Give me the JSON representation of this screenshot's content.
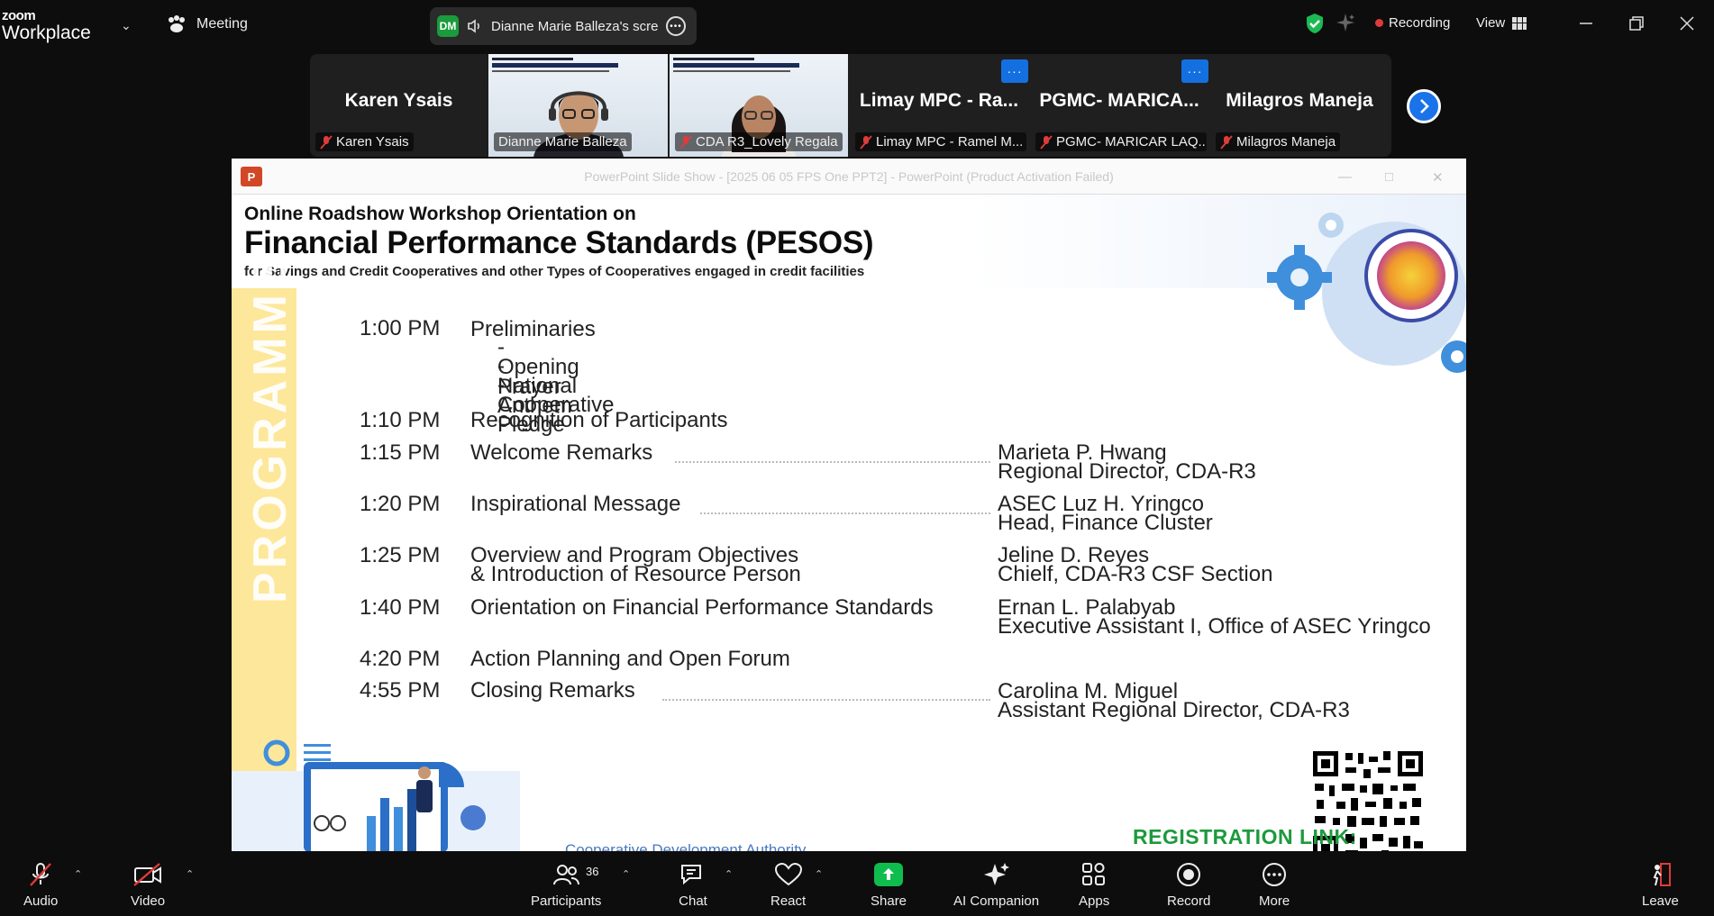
{
  "app": {
    "brand_top": "zoom",
    "brand_bottom": "Workplace",
    "meeting_label": "Meeting",
    "share_initials": "DM",
    "share_label": "Dianne Marie Balleza's screen",
    "recording_label": "Recording",
    "view_label": "View",
    "colors": {
      "accent": "#1a73e8",
      "recording": "#e03b3b",
      "share_green": "#0fbd4f",
      "active_speaker": "#22c55e"
    }
  },
  "gallery": {
    "tiles": [
      {
        "big_name": "Karen Ysais",
        "tag": "Karen Ysais",
        "muted": true
      },
      {
        "big_name": "",
        "tag": "Dianne Marie Balleza",
        "muted": false,
        "video": true,
        "active": true
      },
      {
        "big_name": "",
        "tag": "CDA R3_Lovely Regala",
        "muted": true,
        "video": true
      },
      {
        "big_name": "Limay MPC - Ra...",
        "tag": "Limay MPC - Ramel M...",
        "muted": true,
        "menu": "···"
      },
      {
        "big_name": "PGMC- MARICA...",
        "tag": "PGMC- MARICAR LAQ...",
        "muted": true,
        "menu": "···"
      },
      {
        "big_name": "Milagros Maneja",
        "tag": "Milagros Maneja",
        "muted": true
      }
    ]
  },
  "ppt": {
    "window_title": "PowerPoint Slide Show  -  [2025 06 05 FPS One PPT2]  -  PowerPoint (Product Activation Failed)",
    "icon_letter": "P"
  },
  "slide": {
    "line1": "Online Roadshow Workshop Orientation on",
    "line2": "Financial Performance Standards (PESOS)",
    "line3": "for Savings and Credit Cooperatives and other Types of Cooperatives engaged in credit facilities",
    "band_label": "PROGRAMME",
    "schedule": [
      {
        "time": "1:00 PM",
        "activity": "Preliminaries",
        "speaker": "",
        "speaker_title": ""
      },
      {
        "time": "1:10 PM",
        "activity": "Recognition of Participants",
        "speaker": "",
        "speaker_title": ""
      },
      {
        "time": "1:15 PM",
        "activity": "Welcome Remarks",
        "speaker": "Marieta P. Hwang",
        "speaker_title": "Regional Director, CDA-R3"
      },
      {
        "time": "1:20 PM",
        "activity": "Inspirational Message",
        "speaker": "ASEC Luz H. Yringco",
        "speaker_title": "Head, Finance Cluster"
      },
      {
        "time": "1:25 PM",
        "activity": "Overview and Program Objectives",
        "activity2": "& Introduction of Resource Person",
        "speaker": "Jeline D. Reyes",
        "speaker_title": "Chielf, CDA-R3 CSF Section"
      },
      {
        "time": "1:40 PM",
        "activity": "Orientation on Financial Performance Standards",
        "speaker": "Ernan L. Palabyab",
        "speaker_title": "Executive Assistant I, Office of ASEC Yringco"
      },
      {
        "time": "4:20 PM",
        "activity": "Action Planning and Open Forum",
        "speaker": "",
        "speaker_title": ""
      },
      {
        "time": "4:55 PM",
        "activity": "Closing Remarks",
        "speaker": "Carolina M. Miguel",
        "speaker_title": "Assistant Regional Director, CDA-R3"
      }
    ],
    "prelim_items": [
      "- Opening Prayer",
      "- National Anthem",
      "- Cooperative Pledge"
    ],
    "registration_label": "REGISTRATION LINK:",
    "footer_org": "Cooperative Development Authority"
  },
  "toolbar": {
    "audio": "Audio",
    "video": "Video",
    "participants": "Participants",
    "participants_count": "36",
    "chat": "Chat",
    "react": "React",
    "share": "Share",
    "ai_companion": "AI Companion",
    "apps": "Apps",
    "record": "Record",
    "more": "More",
    "leave": "Leave"
  }
}
